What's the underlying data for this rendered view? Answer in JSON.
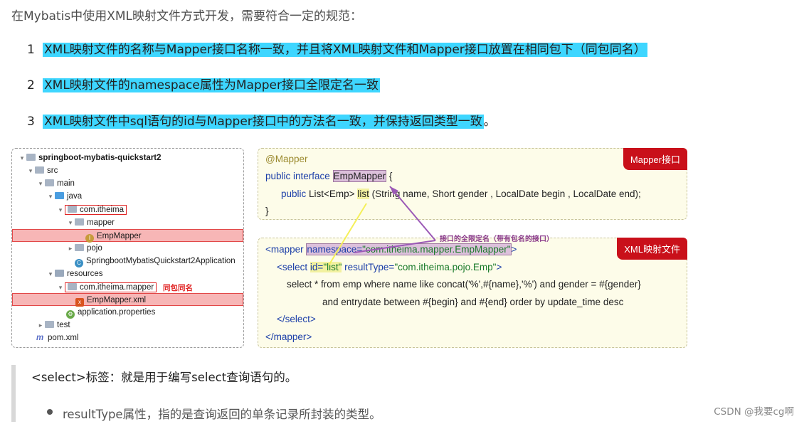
{
  "intro": "在Mybatis中使用XML映射文件方式开发，需要符合一定的规范：",
  "rules": [
    {
      "num": "1",
      "text": "XML映射文件的名称与Mapper接口名称一致，并且将XML映射文件和Mapper接口放置在相同包下（同包同名）"
    },
    {
      "num": "2",
      "text": "XML映射文件的namespace属性为Mapper接口全限定名一致"
    },
    {
      "num": "3",
      "text": "XML映射文件中sql语句的id与Mapper接口中的方法名一致，并保持返回类型一致",
      "suffix": "。"
    }
  ],
  "tree": {
    "root": "springboot-mybatis-quickstart2",
    "src": "src",
    "main": "main",
    "java": "java",
    "pkg": "com.itheima",
    "mapper": "mapper",
    "emp_mapper": "EmpMapper",
    "pojo": "pojo",
    "app": "SpringbootMybatisQuickstart2Application",
    "resources": "resources",
    "res_pkg": "com.itheima.mapper",
    "same_pkg_label": "同包同名",
    "emp_mapper_xml": "EmpMapper.xml",
    "app_props": "application.properties",
    "test": "test",
    "pom": "pom.xml"
  },
  "mapper_card": {
    "badge": "Mapper接口",
    "line1": "@Mapper",
    "line2_kw": "public interface ",
    "line2_name": "EmpMapper",
    "line2_end": " {",
    "line3_kw": "public ",
    "line3_type": "List<Emp> ",
    "line3_method": "list",
    "line3_args": " (String name, Short gender , LocalDate begin , LocalDate end);",
    "line4": "}"
  },
  "xml_card": {
    "badge": "XML映射文件",
    "l1_open": "<mapper ",
    "l1_ns": "namespace=",
    "l1_val": "\"com.itheima.mapper.EmpMapper\"",
    "l1_close": ">",
    "l2_open": "<select ",
    "l2_id": "id=",
    "l2_idval": "\"list\"",
    "l2_rt": " resultType=",
    "l2_rtval": "\"com.itheima.pojo.Emp\"",
    "l2_close": ">",
    "l3": "select * from emp where name like concat('%',#{name},'%') and gender = #{gender}",
    "l4": "and entrydate between #{begin} and #{end} order by update_time desc",
    "l5": "</select>",
    "l6": "</mapper>"
  },
  "purple_note": "接口的全限定名（带有包名的接口）",
  "quote": {
    "line1": "<select>标签：就是用于编写select查询语句的。",
    "line2": "resultType属性，指的是查询返回的单条记录所封装的类型。"
  },
  "watermark": "CSDN @我要cg啊",
  "colors": {
    "highlight": "#3ed6ff",
    "badge": "#c9101a",
    "red": "#e02424",
    "purple": "#8a3a8a",
    "yellow_line": "#f5f05a"
  }
}
